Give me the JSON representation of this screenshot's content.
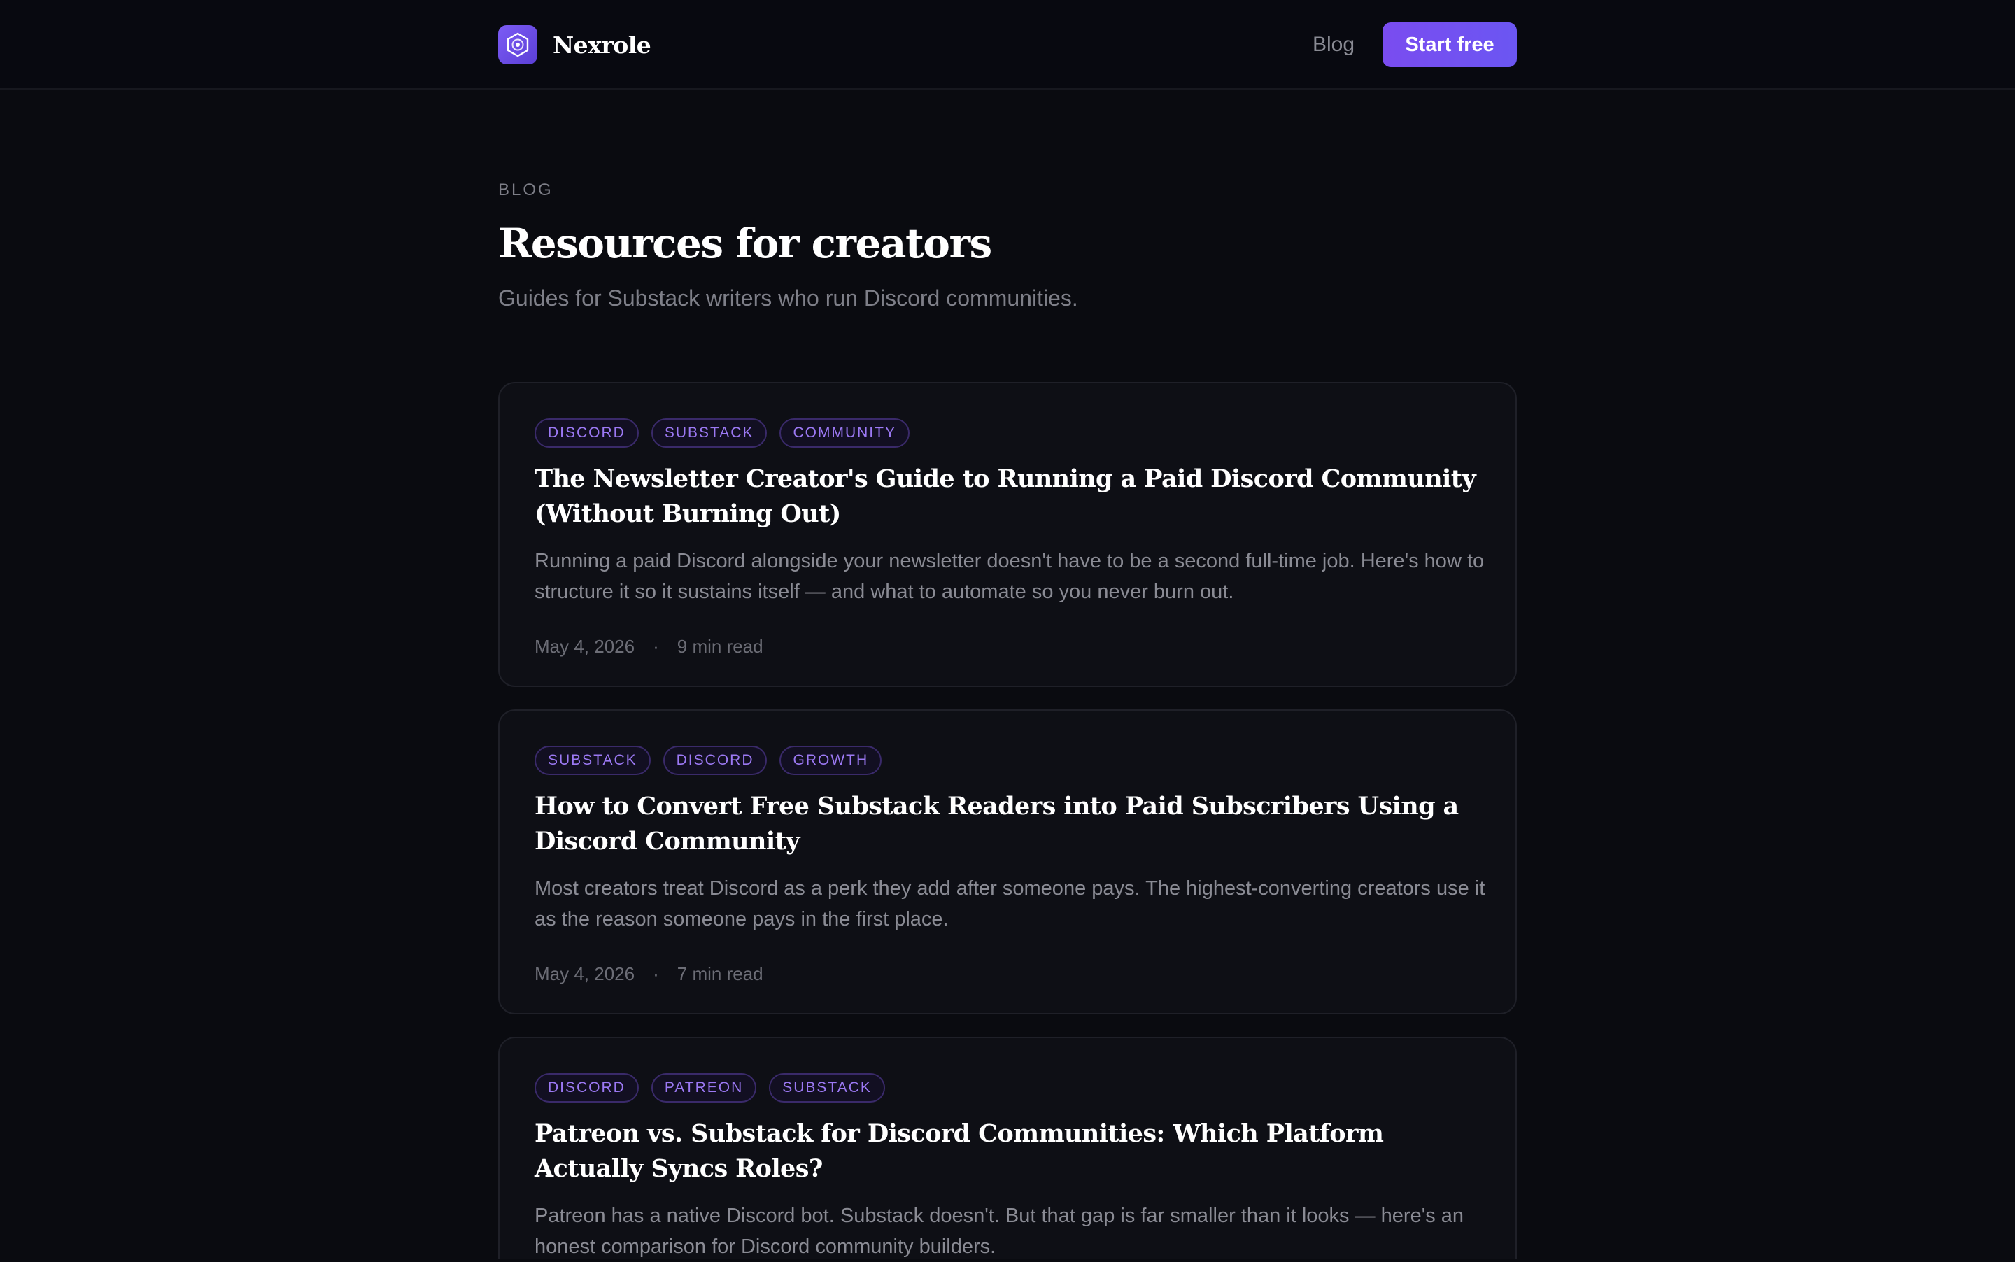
{
  "header": {
    "brand_name": "Nexrole",
    "logo_icon": "hex-node-icon",
    "nav_blog_label": "Blog",
    "cta_label": "Start free"
  },
  "intro": {
    "eyebrow": "BLOG",
    "title": "Resources for creators",
    "subtitle": "Guides for Substack writers who run Discord communities."
  },
  "posts": [
    {
      "tags": [
        "DISCORD",
        "SUBSTACK",
        "COMMUNITY"
      ],
      "title": "The Newsletter Creator's Guide to Running a Paid Discord Community (Without Burning Out)",
      "excerpt": "Running a paid Discord alongside your newsletter doesn't have to be a second full-time job. Here's how to structure it so it sustains itself — and what to automate so you never burn out.",
      "date": "May 4, 2026",
      "read_time": "9 min read"
    },
    {
      "tags": [
        "SUBSTACK",
        "DISCORD",
        "GROWTH"
      ],
      "title": "How to Convert Free Substack Readers into Paid Subscribers Using a Discord Community",
      "excerpt": "Most creators treat Discord as a perk they add after someone pays. The highest-converting creators use it as the reason someone pays in the first place.",
      "date": "May 4, 2026",
      "read_time": "7 min read"
    },
    {
      "tags": [
        "DISCORD",
        "PATREON",
        "SUBSTACK"
      ],
      "title": "Patreon vs. Substack for Discord Communities: Which Platform Actually Syncs Roles?",
      "excerpt": "Patreon has a native Discord bot. Substack doesn't. But that gap is far smaller than it looks — here's an honest comparison for Discord community builders.",
      "date": "",
      "read_time": ""
    }
  ],
  "meta_separator": "·",
  "colors": {
    "background": "#0a0b10",
    "accent": "#7a4cf0",
    "tag_text": "#9c79f4",
    "muted_text": "#8a8b94"
  }
}
